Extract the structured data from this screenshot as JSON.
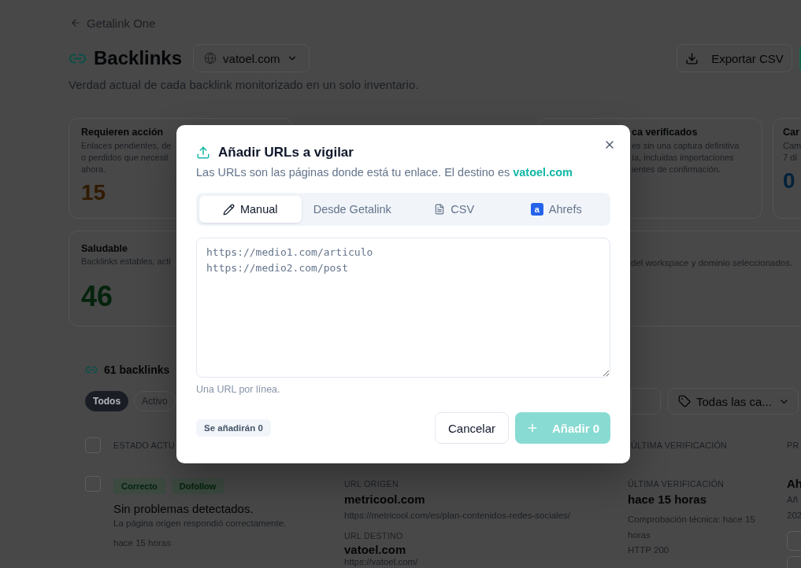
{
  "back_link": {
    "label": "Getalink One"
  },
  "header": {
    "title": "Backlinks",
    "domain": "vatoel.com",
    "export_button": "Exportar CSV"
  },
  "subtitle": "Verdad actual de cada backlink monitorizado en un solo inventario.",
  "stats": [
    {
      "kind": "card",
      "title": "Requieren acción",
      "description": [
        "Enlaces pendientes, de",
        "o perdidos que necesit",
        "ahora."
      ],
      "value": "15",
      "color": "#301a00"
    },
    {
      "kind": "card",
      "title": "ca verificados",
      "description": [
        "es sin una captura definitiva",
        "ía, incluidas importaciones",
        "ientes de confirmación."
      ]
    },
    {
      "kind": "card",
      "title": "Car",
      "description": [
        "Cam",
        "7 dí"
      ],
      "value": "0",
      "color": "#03213a"
    },
    {
      "kind": "wide",
      "title": "Saludable",
      "description": [
        "Backlinks estables, acti"
      ],
      "value": "46",
      "color": "#04230c",
      "note": "del workspace y dominio seleccionados."
    }
  ],
  "list": {
    "count_label": "61 backlinks",
    "filters": [
      {
        "label": "Todos",
        "selected": true
      },
      {
        "label": "Activo",
        "selected": false
      }
    ],
    "category_select": "Todas las ca...",
    "select_all_checked": false,
    "columns": [
      "ESTADO ACTU",
      "ÚLTIMA VERIFICACIÓN",
      "PR"
    ],
    "rows": [
      {
        "checked": false,
        "badges": [
          "Correcto",
          "Dofollow"
        ],
        "status": "Sin problemas detectados.",
        "status_detail": "La página origen respondió correctamente.",
        "status_time": "hace 15 horas",
        "source_label": "URL ORIGEN",
        "source_domain": "metricool.com",
        "source_url": "https://metricool.com/es/plan-contenidos-redes-sociales/",
        "target_label": "URL DESTINO",
        "target_domain": "vatoel.com",
        "target_url": "https://vatoel.com/",
        "check_label": "ÚLTIMA VERIFICACIÓN",
        "check_time": "hace 15 horas",
        "check_detail": "Comprobación técnica: hace 15 horas",
        "check_status": "HTTP 200",
        "column_4": {
          "title": "Ah",
          "lines": [
            "Añ",
            "202"
          ]
        }
      }
    ]
  },
  "dialog": {
    "title": "Añadir URLs a vigilar",
    "subtitle": "Las URLs son las páginas donde está tu enlace. El destino es **vatoel.com**",
    "tabs": [
      {
        "label": "Manual",
        "kind": "edit",
        "selected": true
      },
      {
        "label": "Desde Getalink",
        "kind": "plain",
        "selected": false
      },
      {
        "label": "CSV",
        "kind": "file",
        "selected": false
      },
      {
        "label": "Ahrefs",
        "kind": "brand",
        "logo": "a",
        "selected": false
      }
    ],
    "urls_field": {
      "placeholder": "https://medio1.com/articulo\nhttps://medio2.com/post"
    },
    "hint": "Una URL por línea.",
    "count": "Se añadirán 0",
    "cancel": "Cancelar",
    "submit": {
      "label": "Añadir 0",
      "disabled": true
    }
  }
}
